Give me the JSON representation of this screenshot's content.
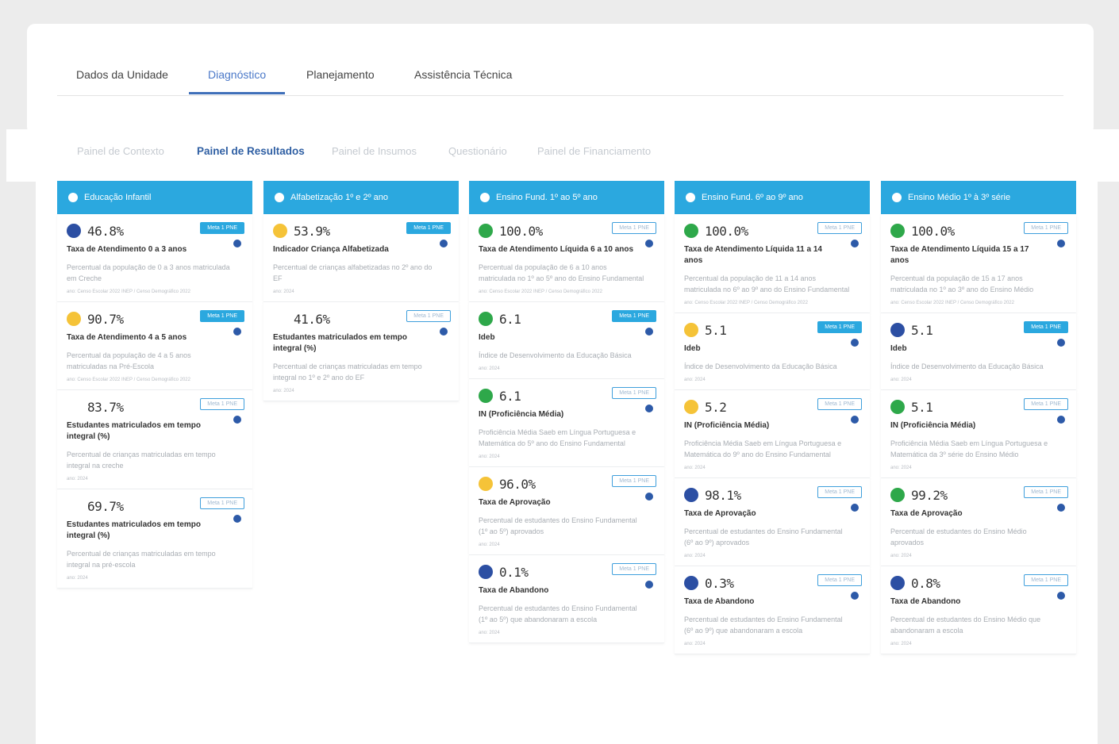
{
  "main_tabs": [
    "Dados da Unidade",
    "Diagnóstico",
    "Planejamento",
    "Assistência Técnica"
  ],
  "sub_tabs": [
    "Painel de Contexto",
    "Painel de Resultados",
    "Painel de Insumos",
    "Questionário",
    "Painel de Financiamento"
  ],
  "badge_label": "Meta 1 PNE",
  "columns": [
    {
      "title": "Educação Infantil",
      "cards": [
        {
          "value": "46.8%",
          "dot": "blue",
          "title": "Taxa de Atendimento 0 a 3 anos",
          "desc": "Percentual da população de 0 a 3 anos matriculada em Creche",
          "src": "ano: Censo Escolar 2022 INEP / Censo Demográfico 2022",
          "filled": true
        },
        {
          "value": "90.7%",
          "dot": "yellow",
          "title": "Taxa de Atendimento 4 a 5 anos",
          "desc": "Percentual da população de 4 a 5 anos matriculadas na Pré-Escola",
          "src": "ano: Censo Escolar 2022 INEP / Censo Demográfico 2022",
          "filled": true
        },
        {
          "value": "83.7%",
          "dot": "",
          "title": "Estudantes matriculados em tempo integral (%)",
          "desc": "Percentual de crianças matriculadas em tempo integral na creche",
          "src": "ano: 2024",
          "filled": false
        },
        {
          "value": "69.7%",
          "dot": "",
          "title": "Estudantes matriculados em tempo integral (%)",
          "desc": "Percentual de crianças matriculadas em tempo integral na pré-escola",
          "src": "ano: 2024",
          "filled": false
        }
      ]
    },
    {
      "title": "Alfabetização 1º e 2º ano",
      "cards": [
        {
          "value": "53.9%",
          "dot": "yellow",
          "title": "Indicador Criança Alfabetizada",
          "desc": "Percentual de crianças alfabetizadas no 2º ano do EF",
          "src": "ano: 2024",
          "filled": true
        },
        {
          "value": "41.6%",
          "dot": "",
          "title": "Estudantes matriculados em tempo integral (%)",
          "desc": "Percentual de crianças matriculadas em tempo integral no 1º e 2º ano do EF",
          "src": "ano: 2024",
          "filled": false
        }
      ]
    },
    {
      "title": "Ensino Fund. 1º ao 5º ano",
      "cards": [
        {
          "value": "100.0%",
          "dot": "green",
          "title": "Taxa de Atendimento Líquida 6 a 10 anos",
          "desc": "Percentual da população de 6 a 10 anos matriculada no 1º ao 5º ano do Ensino Fundamental",
          "src": "ano: Censo Escolar 2022 INEP / Censo Demográfico 2022",
          "filled": false
        },
        {
          "value": "6.1",
          "dot": "green",
          "title": "Ideb",
          "desc": "Índice de Desenvolvimento da Educação Básica",
          "src": "ano: 2024",
          "filled": true
        },
        {
          "value": "6.1",
          "dot": "green",
          "title": "IN (Proficiência Média)",
          "desc": "Proficiência Média Saeb em Língua Portuguesa e Matemática do 5º ano do Ensino Fundamental",
          "src": "ano: 2024",
          "filled": false
        },
        {
          "value": "96.0%",
          "dot": "yellow",
          "title": "Taxa de Aprovação",
          "desc": "Percentual de estudantes do Ensino Fundamental (1º ao 5º) aprovados",
          "src": "ano: 2024",
          "filled": false
        },
        {
          "value": "0.1%",
          "dot": "blue",
          "title": "Taxa de Abandono",
          "desc": "Percentual de estudantes do Ensino Fundamental (1º ao 5º) que abandonaram a escola",
          "src": "ano: 2024",
          "filled": false
        }
      ]
    },
    {
      "title": "Ensino Fund. 6º ao 9º ano",
      "cards": [
        {
          "value": "100.0%",
          "dot": "green",
          "title": "Taxa de Atendimento Líquida 11 a 14 anos",
          "desc": "Percentual da população de 11 a 14 anos matriculada no 6º ao 9º ano do Ensino Fundamental",
          "src": "ano: Censo Escolar 2022 INEP / Censo Demográfico 2022",
          "filled": false
        },
        {
          "value": "5.1",
          "dot": "yellow",
          "title": "Ideb",
          "desc": "Índice de Desenvolvimento da Educação Básica",
          "src": "ano: 2024",
          "filled": true
        },
        {
          "value": "5.2",
          "dot": "yellow",
          "title": "IN (Proficiência Média)",
          "desc": "Proficiência Média Saeb em Língua Portuguesa e Matemática do 9º ano do Ensino Fundamental",
          "src": "ano: 2024",
          "filled": false
        },
        {
          "value": "98.1%",
          "dot": "blue",
          "title": "Taxa de Aprovação",
          "desc": "Percentual de estudantes do Ensino Fundamental (6º ao 9º) aprovados",
          "src": "ano: 2024",
          "filled": false
        },
        {
          "value": "0.3%",
          "dot": "blue",
          "title": "Taxa de Abandono",
          "desc": "Percentual de estudantes do Ensino Fundamental (6º ao 9º) que abandonaram a escola",
          "src": "ano: 2024",
          "filled": false
        }
      ]
    },
    {
      "title": "Ensino Médio 1º à 3º série",
      "cards": [
        {
          "value": "100.0%",
          "dot": "green",
          "title": "Taxa de Atendimento Líquida 15 a 17 anos",
          "desc": "Percentual da população de 15 a 17 anos matriculada no 1º ao 3º ano do Ensino Médio",
          "src": "ano: Censo Escolar 2022 INEP / Censo Demográfico 2022",
          "filled": false
        },
        {
          "value": "5.1",
          "dot": "blue",
          "title": "Ideb",
          "desc": "Índice de Desenvolvimento da Educação Básica",
          "src": "ano: 2024",
          "filled": true
        },
        {
          "value": "5.1",
          "dot": "green",
          "title": "IN (Proficiência Média)",
          "desc": "Proficiência Média Saeb em Língua Portuguesa e Matemática da 3º série do Ensino Médio",
          "src": "ano: 2024",
          "filled": false
        },
        {
          "value": "99.2%",
          "dot": "green",
          "title": "Taxa de Aprovação",
          "desc": "Percentual de estudantes do Ensino Médio aprovados",
          "src": "ano: 2024",
          "filled": false
        },
        {
          "value": "0.8%",
          "dot": "blue",
          "title": "Taxa de Abandono",
          "desc": "Percentual de estudantes do Ensino Médio que abandonaram a escola",
          "src": "ano: 2024",
          "filled": false
        }
      ]
    }
  ]
}
